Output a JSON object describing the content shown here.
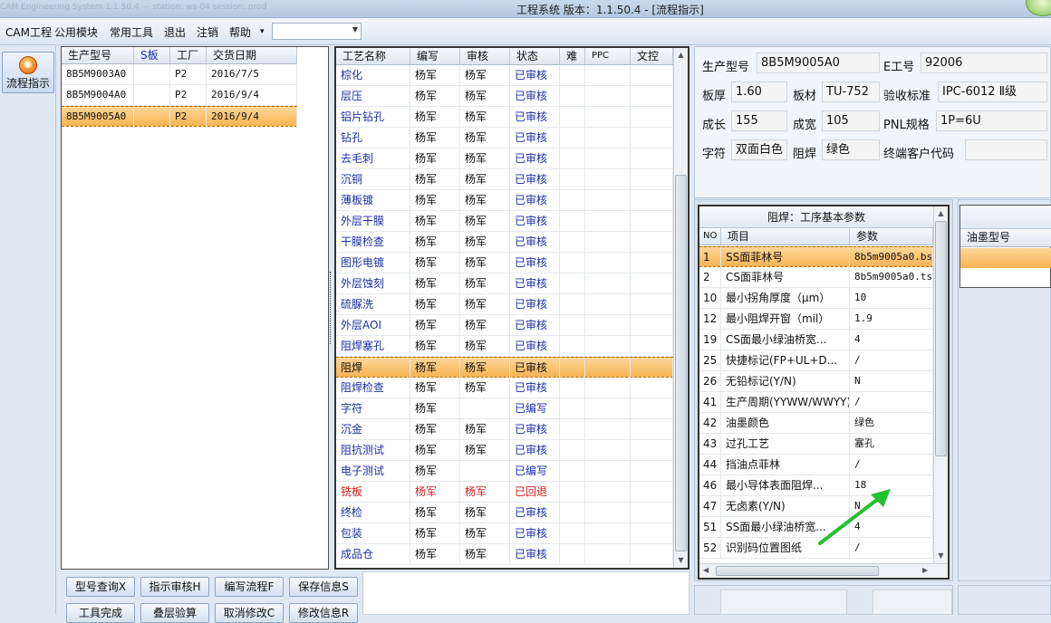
{
  "window": {
    "blur_text": "CAM Engineering System 1.1.50.4 — station: ws-04  session: prod",
    "title": "工程系统   版本：1.1.50.4 - [流程指示]"
  },
  "menu": {
    "items": [
      "CAM工程",
      "公用模块",
      "常用工具",
      "退出",
      "注销",
      "帮助"
    ],
    "help_arrow": "▾",
    "combo_value": ""
  },
  "toolbar": {
    "flow_label": "流程指示"
  },
  "orders": {
    "headers": [
      "生产型号",
      "S板",
      "工厂",
      "交货日期"
    ],
    "rows": [
      [
        "8B5M9003A0",
        "",
        "P2",
        "2016/7/5"
      ],
      [
        "8B5M9004A0",
        "",
        "P2",
        "2016/9/4"
      ],
      [
        "8B5M9005A0",
        "",
        "P2",
        "2016/9/4"
      ]
    ],
    "selected": 2
  },
  "process": {
    "headers": [
      "工艺名称",
      "编写",
      "审核",
      "状态",
      "难",
      "PPC",
      "文控"
    ],
    "rows": [
      [
        "棕化",
        "杨军",
        "杨军",
        "已审核"
      ],
      [
        "层压",
        "杨军",
        "杨军",
        "已审核"
      ],
      [
        "铝片钻孔",
        "杨军",
        "杨军",
        "已审核"
      ],
      [
        "钻孔",
        "杨军",
        "杨军",
        "已审核"
      ],
      [
        "去毛刺",
        "杨军",
        "杨军",
        "已审核"
      ],
      [
        "沉铜",
        "杨军",
        "杨军",
        "已审核"
      ],
      [
        "薄板镀",
        "杨军",
        "杨军",
        "已审核"
      ],
      [
        "外层干膜",
        "杨军",
        "杨军",
        "已审核"
      ],
      [
        "干膜检查",
        "杨军",
        "杨军",
        "已审核"
      ],
      [
        "图形电镀",
        "杨军",
        "杨军",
        "已审核"
      ],
      [
        "外层蚀刻",
        "杨军",
        "杨军",
        "已审核"
      ],
      [
        "硫脲洗",
        "杨军",
        "杨军",
        "已审核"
      ],
      [
        "外层AOI",
        "杨军",
        "杨军",
        "已审核"
      ],
      [
        "阻焊塞孔",
        "杨军",
        "杨军",
        "已审核"
      ],
      [
        "阻焊",
        "杨军",
        "杨军",
        "已审核"
      ],
      [
        "阻焊检查",
        "杨军",
        "杨军",
        "已审核"
      ],
      [
        "字符",
        "杨军",
        "",
        "已编写"
      ],
      [
        "沉金",
        "杨军",
        "杨军",
        "已审核"
      ],
      [
        "阻抗测试",
        "杨军",
        "杨军",
        "已审核"
      ],
      [
        "电子测试",
        "杨军",
        "",
        "已编写"
      ],
      [
        "铣板",
        "杨军",
        "杨军",
        "已回退"
      ],
      [
        "终检",
        "杨军",
        "杨军",
        "已审核"
      ],
      [
        "包装",
        "杨军",
        "杨军",
        "已审核"
      ],
      [
        "成品仓",
        "杨军",
        "杨军",
        "已审核"
      ]
    ],
    "selected": 14,
    "highlight_red": 20
  },
  "info": {
    "model_label": "生产型号",
    "model": "8B5M9005A0",
    "eno_label": "E工号",
    "eno": "92006",
    "thick_label": "板厚",
    "thick": "1.60",
    "material_label": "板材",
    "material": "TU-752",
    "std_label": "验收标准",
    "std": "IPC-6012 Ⅱ级",
    "len_label": "成长",
    "len": "155",
    "wid_label": "成宽",
    "wid": "105",
    "pnl_label": "PNL规格",
    "pnl": "1P=6U",
    "char_label": "字符",
    "char": "双面白色",
    "mask_label": "阻焊",
    "mask": "绿色",
    "cust_label": "终端客户代码",
    "cust": ""
  },
  "params": {
    "title": "阻焊：工序基本参数",
    "headers": [
      "NO",
      "项目",
      "参数"
    ],
    "rows": [
      [
        "1",
        "SS面菲林号",
        "8b5m9005a0.bs"
      ],
      [
        "2",
        "CS面菲林号",
        "8b5m9005a0.ts"
      ],
      [
        "10",
        "最小拐角厚度（μm）",
        "10"
      ],
      [
        "12",
        "最小阻焊开窗（mil）",
        "1.9"
      ],
      [
        "19",
        "CS面最小绿油桥宽...",
        "4"
      ],
      [
        "25",
        "快捷标记(FP+UL+D...",
        "/"
      ],
      [
        "26",
        "无铅标记(Y/N)",
        "N"
      ],
      [
        "41",
        "生产周期(YYWW/WWYY)",
        "/"
      ],
      [
        "42",
        "油墨颜色",
        "绿色"
      ],
      [
        "43",
        "过孔工艺",
        "塞孔"
      ],
      [
        "44",
        "挡油点菲林",
        "/"
      ],
      [
        "46",
        "最小导体表面阻焊...",
        "18"
      ],
      [
        "47",
        "无卤素(Y/N)",
        "N"
      ],
      [
        "51",
        "SS面最小绿油桥宽...",
        "4"
      ],
      [
        "52",
        "识别码位置图纸",
        "/"
      ]
    ],
    "selected": 0
  },
  "ink": {
    "header": "油墨型号"
  },
  "buttons": {
    "row1": [
      "型号查询X",
      "指示审核H",
      "编写流程F",
      "保存信息S"
    ],
    "row2": [
      "工具完成",
      "叠层验算",
      "取消修改C",
      "修改信息R"
    ]
  },
  "colors": {
    "accent": "#f7b354",
    "status_blue": "#1b2fa8",
    "status_red": "#d61b1b",
    "arrow_green": "#22c231"
  }
}
